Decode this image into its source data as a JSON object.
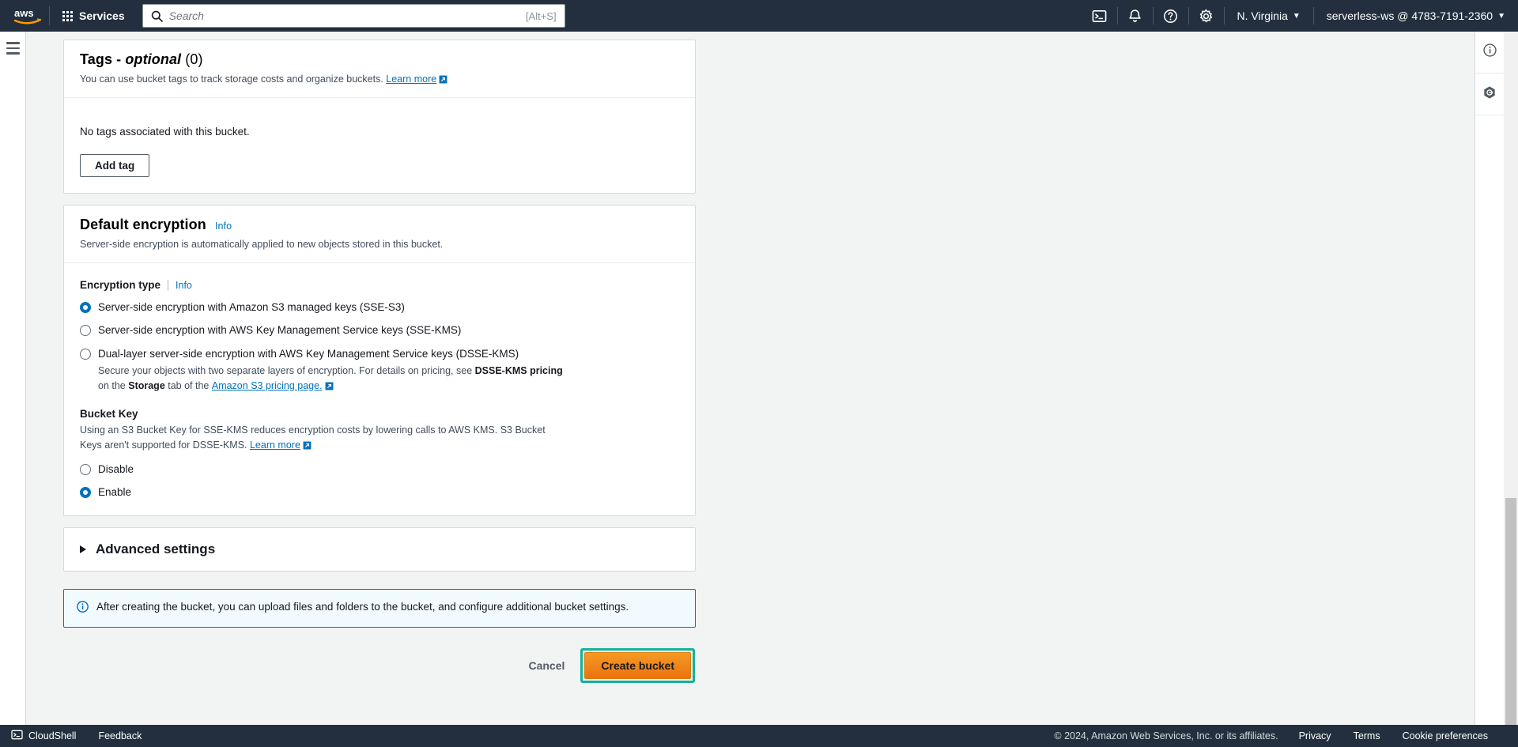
{
  "topnav": {
    "logo_alt": "aws",
    "services_label": "Services",
    "search": {
      "placeholder": "Search",
      "shortcut": "[Alt+S]"
    },
    "cloudshell_icon": "cloudshell-icon",
    "notifications_icon": "bell-icon",
    "help_icon": "question-circle-icon",
    "settings_icon": "gear-icon",
    "region": "N. Virginia",
    "account": "serverless-ws @ 4783-7191-2360"
  },
  "rails": {
    "menu_icon": "hamburger-menu-icon",
    "info_icon": "info-circle-icon",
    "shortcuts_icon": "hexagon-settings-icon"
  },
  "tags": {
    "title_main": "Tags - ",
    "title_italic": "optional",
    "count": " (0)",
    "description": "You can use bucket tags to track storage costs and organize buckets.",
    "learn_more": "Learn more",
    "empty_text": "No tags associated with this bucket.",
    "add_tag_label": "Add tag"
  },
  "encryption": {
    "title": "Default encryption",
    "info_label": "Info",
    "description": "Server-side encryption is automatically applied to new objects stored in this bucket.",
    "type_label": "Encryption type",
    "type_info": "Info",
    "options": [
      {
        "label": "Server-side encryption with Amazon S3 managed keys (SSE-S3)",
        "selected": true
      },
      {
        "label": "Server-side encryption with AWS Key Management Service keys (SSE-KMS)",
        "selected": false
      },
      {
        "label": "Dual-layer server-side encryption with AWS Key Management Service keys (DSSE-KMS)",
        "selected": false
      }
    ],
    "dsse_desc_1": "Secure your objects with two separate layers of encryption. For details on pricing, see ",
    "dsse_bold_1": "DSSE-KMS pricing",
    "dsse_desc_2": " on the ",
    "dsse_bold_2": "Storage",
    "dsse_desc_3": " tab of the ",
    "dsse_link": "Amazon S3 pricing page.",
    "bucket_key_label": "Bucket Key",
    "bucket_key_desc": "Using an S3 Bucket Key for SSE-KMS reduces encryption costs by lowering calls to AWS KMS. S3 Bucket Keys aren't supported for DSSE-KMS. ",
    "bucket_key_link": "Learn more",
    "bucket_key_options": [
      {
        "label": "Disable",
        "selected": false
      },
      {
        "label": "Enable",
        "selected": true
      }
    ]
  },
  "advanced": {
    "title": "Advanced settings",
    "expanded": false,
    "icon": "triangle-right-icon"
  },
  "alert": {
    "icon": "info-circle-icon",
    "text": "After creating the bucket, you can upload files and folders to the bucket, and configure additional bucket settings."
  },
  "actions": {
    "cancel_label": "Cancel",
    "create_label": "Create bucket",
    "highlight_color": "#12b39a",
    "primary_color": "#ec7211"
  },
  "footer": {
    "cloudshell_label": "CloudShell",
    "cloudshell_icon": "cloudshell-icon",
    "feedback_label": "Feedback",
    "copyright": "© 2024, Amazon Web Services, Inc. or its affiliates.",
    "privacy": "Privacy",
    "terms": "Terms",
    "cookie_preferences": "Cookie preferences"
  }
}
